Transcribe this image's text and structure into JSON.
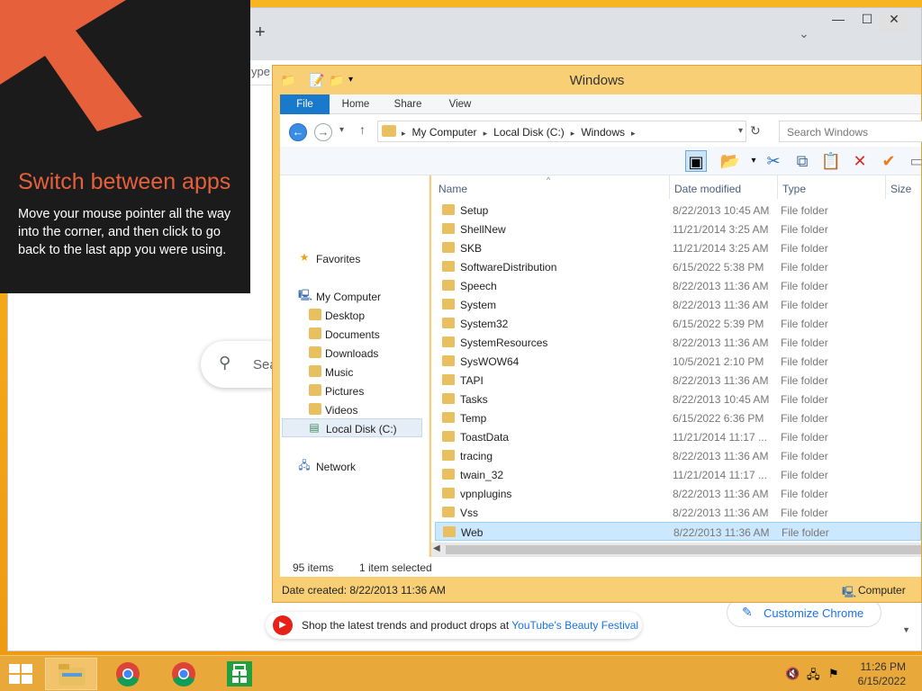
{
  "chrome": {
    "new_tab_glyph": "+",
    "tab_dropdown_glyph": "⌄",
    "minimize_glyph": "—",
    "maximize_glyph": "☐",
    "close_glyph": "✕",
    "omnibox_placeholder": "ype a URL",
    "search_placeholder": "Sea",
    "promo_text": "Shop the latest trends and product drops at ",
    "promo_link": "YouTube's Beauty Festival",
    "customize_label": "Customize Chrome"
  },
  "tip": {
    "title": "Switch between apps",
    "body": "Move your mouse pointer all the way into the corner, and then click to go back to the last app you were using.",
    "accent_color": "#e5603b"
  },
  "explorer": {
    "title": "Windows",
    "ribbon_tabs": [
      "File",
      "Home",
      "Share",
      "View"
    ],
    "breadcrumb": [
      "My Computer",
      "Local Disk (C:)",
      "Windows"
    ],
    "search_placeholder": "Search Windows",
    "nav": {
      "favorites": "Favorites",
      "my_computer": "My Computer",
      "desktop": "Desktop",
      "documents": "Documents",
      "downloads": "Downloads",
      "music": "Music",
      "pictures": "Pictures",
      "videos": "Videos",
      "local_disk": "Local Disk (C:)",
      "network": "Network"
    },
    "columns": {
      "name": "Name",
      "date": "Date modified",
      "type": "Type",
      "size": "Size"
    },
    "files": [
      {
        "name": "Setup",
        "date": "8/22/2013 10:45 AM",
        "type": "File folder"
      },
      {
        "name": "ShellNew",
        "date": "11/21/2014 3:25 AM",
        "type": "File folder"
      },
      {
        "name": "SKB",
        "date": "11/21/2014 3:25 AM",
        "type": "File folder"
      },
      {
        "name": "SoftwareDistribution",
        "date": "6/15/2022 5:38 PM",
        "type": "File folder"
      },
      {
        "name": "Speech",
        "date": "8/22/2013 11:36 AM",
        "type": "File folder"
      },
      {
        "name": "System",
        "date": "8/22/2013 11:36 AM",
        "type": "File folder"
      },
      {
        "name": "System32",
        "date": "6/15/2022 5:39 PM",
        "type": "File folder"
      },
      {
        "name": "SystemResources",
        "date": "8/22/2013 11:36 AM",
        "type": "File folder"
      },
      {
        "name": "SysWOW64",
        "date": "10/5/2021 2:10 PM",
        "type": "File folder"
      },
      {
        "name": "TAPI",
        "date": "8/22/2013 11:36 AM",
        "type": "File folder"
      },
      {
        "name": "Tasks",
        "date": "8/22/2013 10:45 AM",
        "type": "File folder"
      },
      {
        "name": "Temp",
        "date": "6/15/2022 6:36 PM",
        "type": "File folder"
      },
      {
        "name": "ToastData",
        "date": "11/21/2014 11:17 ...",
        "type": "File folder"
      },
      {
        "name": "tracing",
        "date": "8/22/2013 11:36 AM",
        "type": "File folder"
      },
      {
        "name": "twain_32",
        "date": "11/21/2014 11:17 ...",
        "type": "File folder"
      },
      {
        "name": "vpnplugins",
        "date": "8/22/2013 11:36 AM",
        "type": "File folder"
      },
      {
        "name": "Vss",
        "date": "8/22/2013 11:36 AM",
        "type": "File folder"
      },
      {
        "name": "Web",
        "date": "8/22/2013 11:36 AM",
        "type": "File folder",
        "selected": true
      }
    ],
    "status_items": "95 items",
    "status_selected": "1 item selected",
    "details_created": "Date created: 8/22/2013 11:36 AM",
    "details_location": "Computer"
  },
  "taskbar": {
    "time": "11:26 PM",
    "date": "6/15/2022"
  }
}
